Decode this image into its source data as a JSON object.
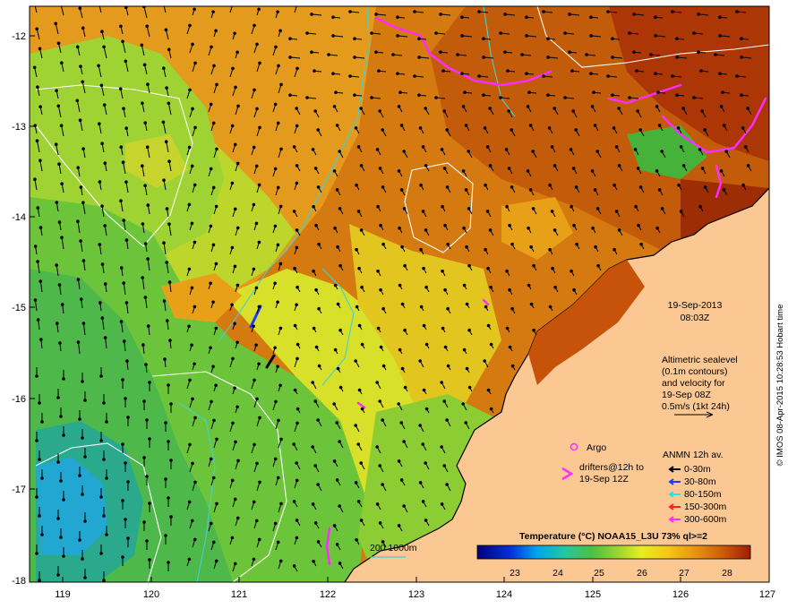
{
  "map": {
    "longitudes": [
      "119",
      "120",
      "121",
      "122",
      "123",
      "124",
      "125",
      "126",
      "127"
    ],
    "latitudes": [
      "-12",
      "-13",
      "-14",
      "-15",
      "-16",
      "-17",
      "-18"
    ],
    "datetime": {
      "date": "19-Sep-2013",
      "time": "08:03Z"
    },
    "altimetry_note": [
      "Altimetric sealevel",
      "(0.1m contours)",
      "and velocity for",
      "19-Sep 08Z",
      "0.5m/s (1kt 24h)"
    ],
    "argo_label": "Argo",
    "drifters_label": [
      "drifters@12h to",
      "19-Sep 12Z"
    ],
    "anmn": {
      "title": "ANMN 12h av.",
      "items": [
        {
          "label": "0-30m",
          "color": "#000000"
        },
        {
          "label": "30-80m",
          "color": "#1a3cff"
        },
        {
          "label": "80-150m",
          "color": "#2fe0e0"
        },
        {
          "label": "150-300m",
          "color": "#ff2020"
        },
        {
          "label": "300-600m",
          "color": "#ff2bff"
        }
      ]
    },
    "isobath_label": "200 1000m",
    "colorbar": {
      "title": "Temperature (°C) NOAA15_L3U 73% ql>=2",
      "ticks": [
        "23",
        "24",
        "25",
        "26",
        "27",
        "28"
      ]
    },
    "credit": "© IMOS 08-Apr-2015 10:28:53 Hobart time",
    "colors": {
      "land": "#fbc894",
      "warm": "#c65a06",
      "hot": "#b33808",
      "mid": "#e3a11a",
      "cool": "#9ed631",
      "cooler": "#55bb38",
      "coolest": "#28a889",
      "contour": "#48cfcf",
      "drifter": "#ff2bff"
    }
  }
}
